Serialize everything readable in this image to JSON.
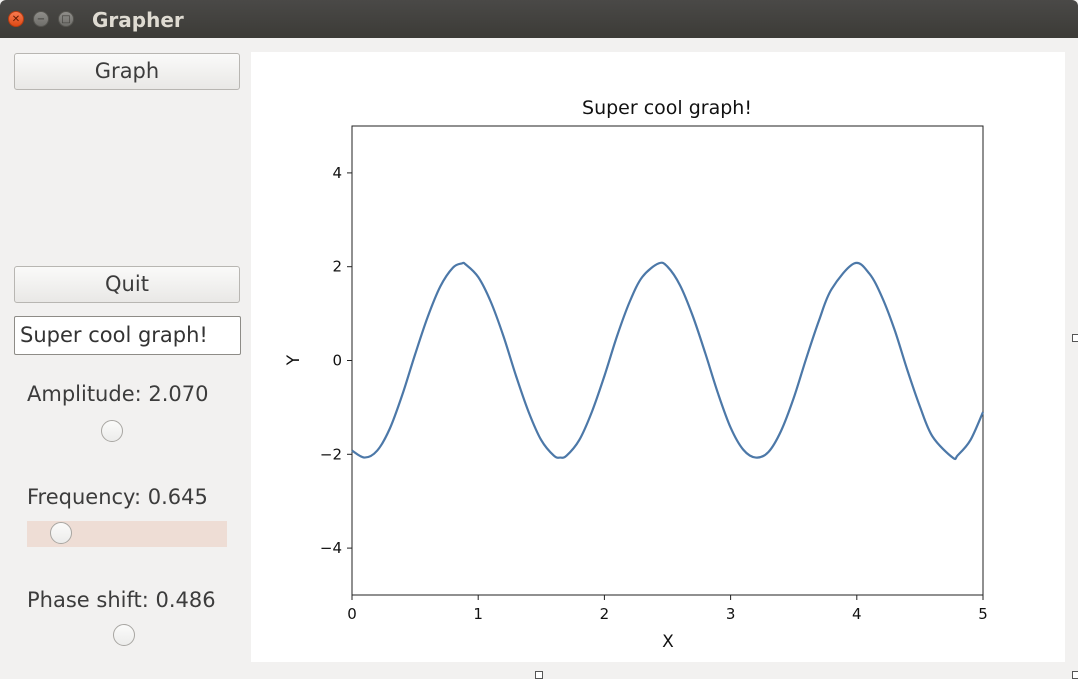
{
  "window": {
    "title": "Grapher"
  },
  "controls": {
    "graph_button": "Graph",
    "quit_button": "Quit",
    "title_field_value": "Super cool graph!",
    "amplitude_label": "Amplitude: 2.070",
    "frequency_label": "Frequency: 0.645",
    "phase_label": "Phase shift: 0.486"
  },
  "chart_data": {
    "type": "line",
    "title": "Super cool graph!",
    "xlabel": "X",
    "ylabel": "Y",
    "xlim": [
      0,
      5
    ],
    "ylim": [
      -5,
      5
    ],
    "xticks": [
      "0",
      "1",
      "2",
      "3",
      "4",
      "5"
    ],
    "yticks": [
      "−4",
      "−2",
      "0",
      "2",
      "4"
    ],
    "series": [
      {
        "color": "#4c78a8",
        "x": [
          0,
          0.1,
          0.2,
          0.3,
          0.4,
          0.5,
          0.6,
          0.7,
          0.8,
          0.87,
          0.9,
          1.0,
          1.1,
          1.2,
          1.3,
          1.4,
          1.5,
          1.6,
          1.65,
          1.7,
          1.8,
          1.9,
          2.0,
          2.1,
          2.2,
          2.3,
          2.43,
          2.5,
          2.6,
          2.7,
          2.8,
          2.9,
          3.0,
          3.1,
          3.2,
          3.3,
          3.4,
          3.5,
          3.6,
          3.7,
          3.8,
          3.98,
          4.1,
          4.2,
          4.3,
          4.4,
          4.5,
          4.6,
          4.76,
          4.8,
          4.9,
          5.0
        ],
        "y": [
          -1.92,
          -2.07,
          -1.92,
          -1.45,
          -0.72,
          0.13,
          0.93,
          1.58,
          1.98,
          2.07,
          2.05,
          1.78,
          1.25,
          0.52,
          -0.33,
          -1.1,
          -1.7,
          -2.03,
          -2.07,
          -2.03,
          -1.7,
          -1.1,
          -0.33,
          0.52,
          1.25,
          1.78,
          2.07,
          2.0,
          1.6,
          0.95,
          0.15,
          -0.7,
          -1.43,
          -1.9,
          -2.07,
          -1.95,
          -1.5,
          -0.8,
          0.05,
          0.85,
          1.52,
          2.07,
          1.85,
          1.35,
          0.65,
          -0.2,
          -0.98,
          -1.62,
          -2.07,
          -2.02,
          -1.7,
          -1.1
        ]
      }
    ]
  }
}
